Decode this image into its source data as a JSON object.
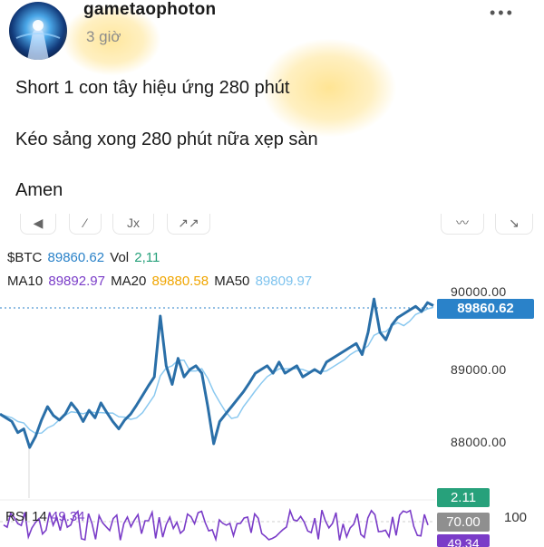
{
  "post": {
    "username": "gametaophoton",
    "timestamp": "3 giờ",
    "more_icon": "•••",
    "lines": [
      "Short 1 con tây hiệu ứng 280 phút",
      "Kéo sảng xong 280 phút nữa xẹp sàn",
      "Amen"
    ]
  },
  "toolbar": {
    "tools": [
      "◀",
      "⁄",
      "Jx",
      "↗↗",
      "〰",
      "↘"
    ]
  },
  "chart": {
    "symbol_label": "$BTC",
    "price": "89860.62",
    "vol_label": "Vol",
    "vol": "2,11",
    "ma10_label": "MA10",
    "ma10": "89892.97",
    "ma20_label": "MA20",
    "ma20": "89880.58",
    "ma50_label": "MA50",
    "ma50": "89809.97",
    "price_tag": "89860.62",
    "axis_top": "90000.00",
    "axis_mid": "89000.00",
    "axis_low": "88000.00",
    "vol_tag": "2.11",
    "rsi_label": "RSI 14",
    "rsi_value": "49.34",
    "rsi_70_tag": "70.00",
    "rsi_tag": "49.34",
    "rsi_axis": "100"
  },
  "colors": {
    "price": "#2a82c9",
    "vol": "#27a17b",
    "ma10": "#7a3cc8",
    "ma20": "#f0a500",
    "ma50": "#7ec3ee",
    "highlight": "#ffd34d",
    "rsi": "#7a3cc8"
  },
  "chart_data": {
    "type": "line",
    "title": "",
    "ylim": [
      87400,
      90200
    ],
    "y_ticks": [
      88000,
      89000,
      90000
    ],
    "series": [
      {
        "name": "$BTC",
        "values": [
          88400,
          88350,
          88300,
          88150,
          88200,
          87950,
          88100,
          88320,
          88500,
          88380,
          88320,
          88400,
          88550,
          88450,
          88300,
          88450,
          88350,
          88550,
          88420,
          88300,
          88200,
          88320,
          88400,
          88520,
          88650,
          88780,
          88900,
          89720,
          89050,
          88800,
          89150,
          88900,
          89000,
          89050,
          88950,
          88500,
          88000,
          88300,
          88400,
          88500,
          88600,
          88700,
          88820,
          88950,
          89000,
          89050,
          88950,
          89100,
          88950,
          89000,
          89050,
          88900,
          88950,
          89000,
          88950,
          89100,
          89150,
          89200,
          89250,
          89300,
          89350,
          89200,
          89500,
          89950,
          89500,
          89400,
          89600,
          89700,
          89750,
          89800,
          89850,
          89780,
          89900,
          89860
        ]
      }
    ]
  }
}
